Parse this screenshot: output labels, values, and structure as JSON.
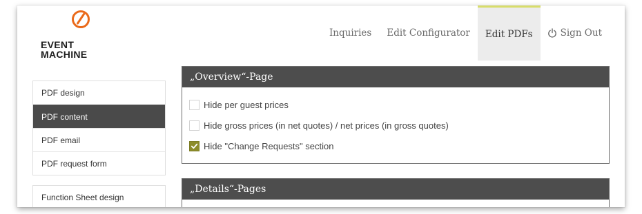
{
  "logo": {
    "line1": "EVENT",
    "line2": "MACHINE"
  },
  "colors": {
    "accent": "#ea6a1a",
    "checkbox_checked": "#8c8c2a",
    "active_nav_bar": "#d8dd6a",
    "panel_header": "#4d4d4d"
  },
  "nav": {
    "items": [
      {
        "label": "Inquiries",
        "active": false
      },
      {
        "label": "Edit Configurator",
        "active": false
      },
      {
        "label": "Edit PDFs",
        "active": true
      }
    ],
    "signout": {
      "label": "Sign Out",
      "icon": "power-icon"
    }
  },
  "sidebar": {
    "group1": [
      {
        "label": "PDF design",
        "active": false
      },
      {
        "label": "PDF content",
        "active": true
      },
      {
        "label": "PDF email",
        "active": false
      },
      {
        "label": "PDF request form",
        "active": false
      }
    ],
    "group2": [
      {
        "label": "Function Sheet design",
        "active": false
      }
    ]
  },
  "overview_panel": {
    "title": "„Overview“-Page",
    "options": [
      {
        "label": "Hide per guest prices",
        "checked": false
      },
      {
        "label": "Hide gross prices (in net quotes) / net prices (in gross quotes)",
        "checked": false
      },
      {
        "label": "Hide \"Change Requests\" section",
        "checked": true
      }
    ]
  },
  "details_panel": {
    "title": "„Details“-Pages"
  }
}
